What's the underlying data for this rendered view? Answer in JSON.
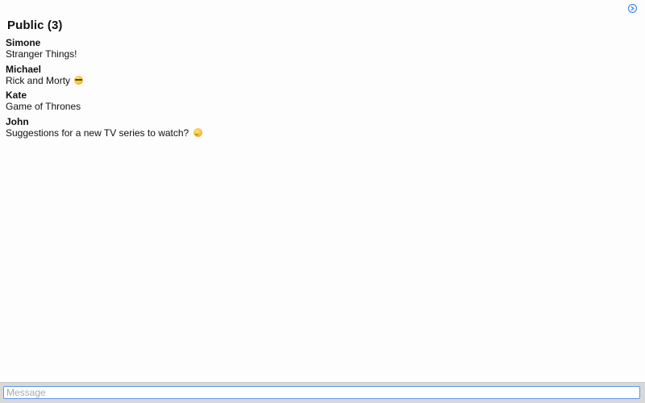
{
  "header": {
    "title": "Public (3)"
  },
  "messages": [
    {
      "sender": "Simone",
      "text": "Stranger Things!",
      "emoji": ""
    },
    {
      "sender": "Michael",
      "text": "Rick and Morty",
      "emoji": "nerd-face"
    },
    {
      "sender": "Kate",
      "text": "Game of Thrones",
      "emoji": ""
    },
    {
      "sender": "John",
      "text": "Suggestions for a new TV series to watch?",
      "emoji": "thinking-face"
    }
  ],
  "composer": {
    "placeholder": "Message",
    "value": ""
  },
  "colors": {
    "accent": "#2a7de1",
    "input_border": "#5a9af0",
    "composer_bg": "#d8d8d8"
  },
  "icons": {
    "top_right": "circle-arrow-right-icon"
  }
}
